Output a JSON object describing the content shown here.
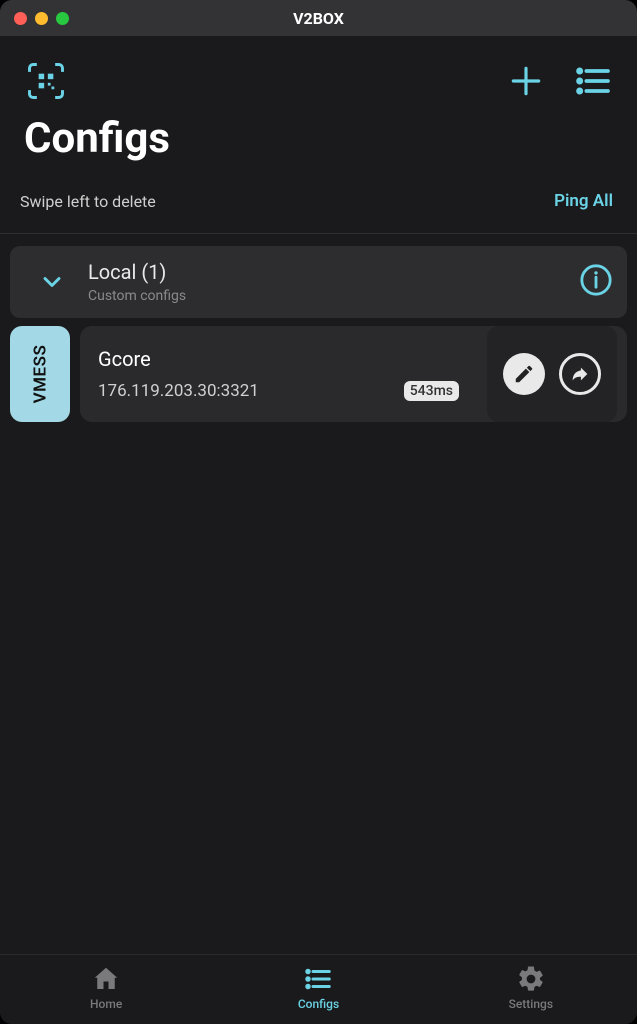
{
  "window": {
    "title": "V2BOX"
  },
  "page": {
    "title": "Configs",
    "hint": "Swipe left to delete",
    "ping_all": "Ping All"
  },
  "group": {
    "title": "Local (1)",
    "subtitle": "Custom configs"
  },
  "config": {
    "protocol": "VMESS",
    "name": "Gcore",
    "address": "176.119.203.30:3321",
    "ping": "543ms"
  },
  "tabs": {
    "home": "Home",
    "configs": "Configs",
    "settings": "Settings"
  },
  "colors": {
    "accent": "#6bd3e6",
    "bg": "#1a1a1c",
    "card": "#2a2a2c"
  }
}
